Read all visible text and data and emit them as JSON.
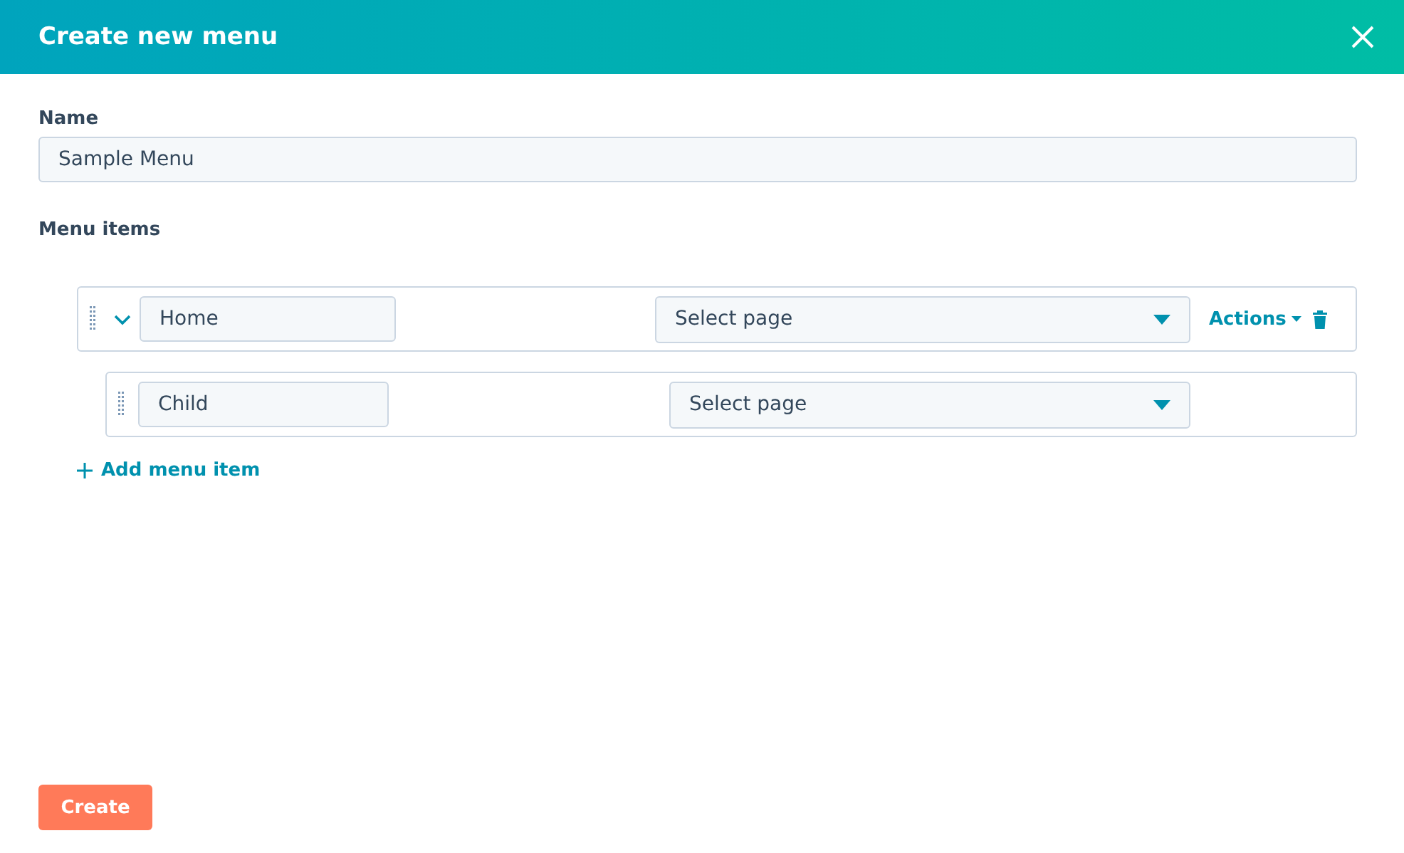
{
  "dialog": {
    "title": "Create new menu"
  },
  "name_field": {
    "label": "Name",
    "value": "Sample Menu"
  },
  "menu_items_label": "Menu items",
  "menu_items": [
    {
      "name": "Home",
      "page_placeholder": "Select page",
      "expanded": true,
      "actions_label": "Actions",
      "children": [
        {
          "name": "Child",
          "page_placeholder": "Select page"
        }
      ]
    }
  ],
  "add_item_label": "Add menu item",
  "buttons": [
    {
      "label": "Create"
    }
  ]
}
